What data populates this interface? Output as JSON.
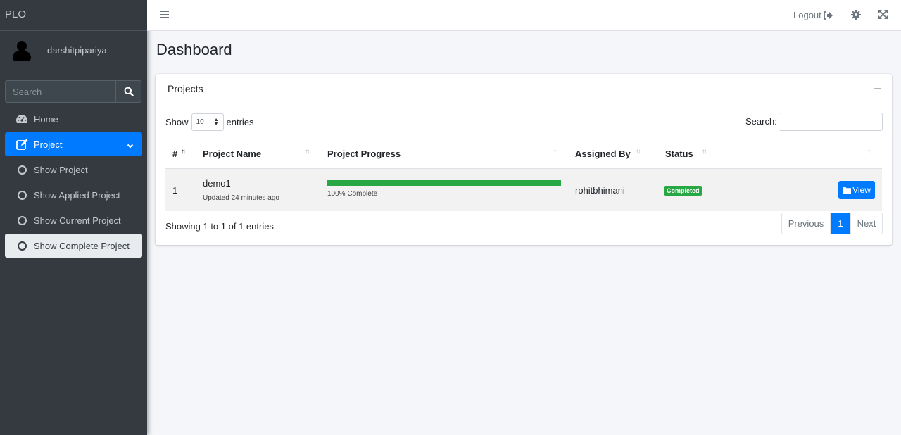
{
  "brand": "PLO",
  "user": {
    "name": "darshitpipariya"
  },
  "sidebar_search": {
    "placeholder": "Search"
  },
  "nav": {
    "home": "Home",
    "project": "Project",
    "show_project": "Show Project",
    "show_applied": "Show Applied Project",
    "show_current": "Show Current Project",
    "show_complete": "Show Complete Project"
  },
  "topbar": {
    "logout": "Logout"
  },
  "page": {
    "title": "Dashboard"
  },
  "card": {
    "title": "Projects"
  },
  "table_controls": {
    "show": "Show",
    "entries_value": "10",
    "entries": "entries",
    "search_label": "Search:"
  },
  "table": {
    "headers": {
      "num": "#",
      "name": "Project Name",
      "progress": "Project Progress",
      "assigned": "Assigned By",
      "status": "Status"
    },
    "rows": [
      {
        "num": "1",
        "name": "demo1",
        "updated": "Updated 24 minutes ago",
        "progress_value": 100,
        "progress_text": "100% Complete",
        "assigned_by": "rohitbhimani",
        "status": "Completed",
        "action": "View"
      }
    ]
  },
  "footer": {
    "info": "Showing 1 to 1 of 1 entries",
    "prev": "Previous",
    "page": "1",
    "next": "Next"
  },
  "colors": {
    "primary": "#007bff",
    "success": "#28a745",
    "sidebar": "#343a40"
  }
}
